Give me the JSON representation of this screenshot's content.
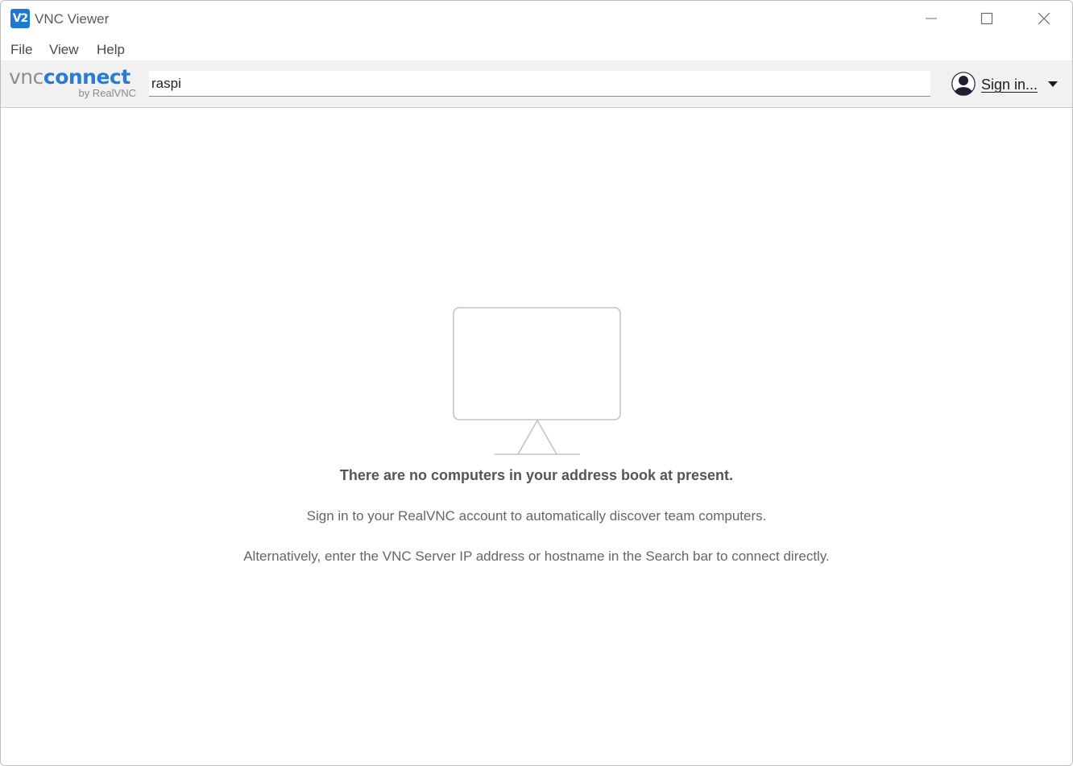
{
  "window": {
    "title": "VNC Viewer",
    "app_icon_text": "V2",
    "controls": {
      "minimize": "minimize-icon",
      "maximize": "maximize-icon",
      "close": "close-icon"
    }
  },
  "menu": {
    "items": [
      "File",
      "View",
      "Help"
    ]
  },
  "toolbar": {
    "logo": {
      "vnc": "vnc",
      "connect": "connect",
      "by": "by RealVNC"
    },
    "search": {
      "value": "raspi",
      "placeholder": ""
    },
    "signin": {
      "label": "Sign in...",
      "avatar_icon": "user-avatar-icon",
      "chevron_icon": "chevron-down-icon"
    }
  },
  "empty_state": {
    "icon": "monitor-icon",
    "title": "There are no computers in your address book at present.",
    "line1": "Sign in to your RealVNC account to automatically discover team computers.",
    "line2": "Alternatively, enter the VNC Server IP address or hostname in the Search bar to connect directly."
  },
  "colors": {
    "accent": "#2a7bd2",
    "toolbar_bg": "#f1f1f1",
    "text_muted": "#666666"
  }
}
